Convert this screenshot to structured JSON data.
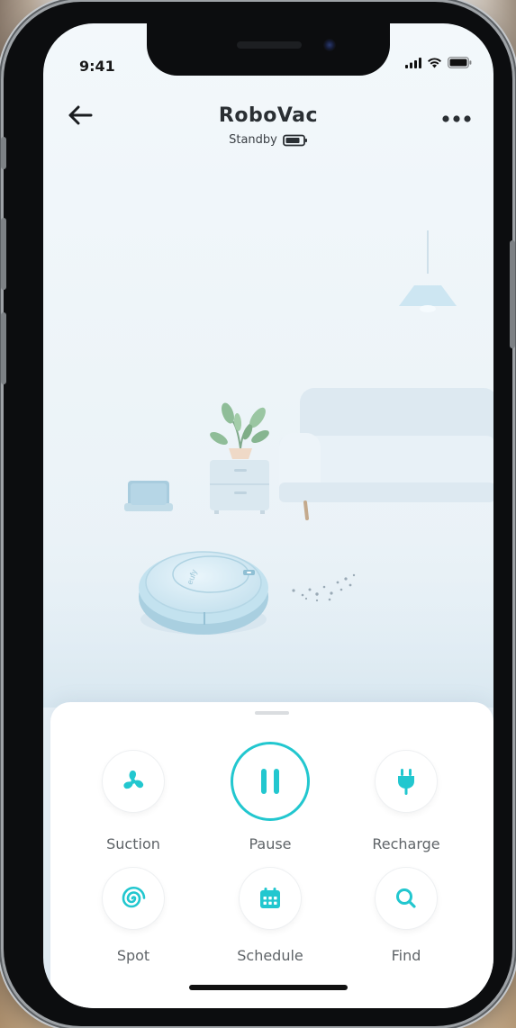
{
  "status_bar": {
    "time": "9:41"
  },
  "header": {
    "title": "RoboVac",
    "status": "Standby",
    "robot_brand": "eufy"
  },
  "controls": {
    "suction": {
      "label": "Suction",
      "icon": "fan-icon"
    },
    "pause": {
      "label": "Pause",
      "icon": "pause-icon"
    },
    "recharge": {
      "label": "Recharge",
      "icon": "plug-icon"
    },
    "spot": {
      "label": "Spot",
      "icon": "spiral-icon"
    },
    "schedule": {
      "label": "Schedule",
      "icon": "calendar-icon"
    },
    "find": {
      "label": "Find",
      "icon": "search-icon"
    }
  },
  "colors": {
    "accent": "#22c7cf",
    "text": "#2a2f33",
    "label": "#5f6468"
  }
}
